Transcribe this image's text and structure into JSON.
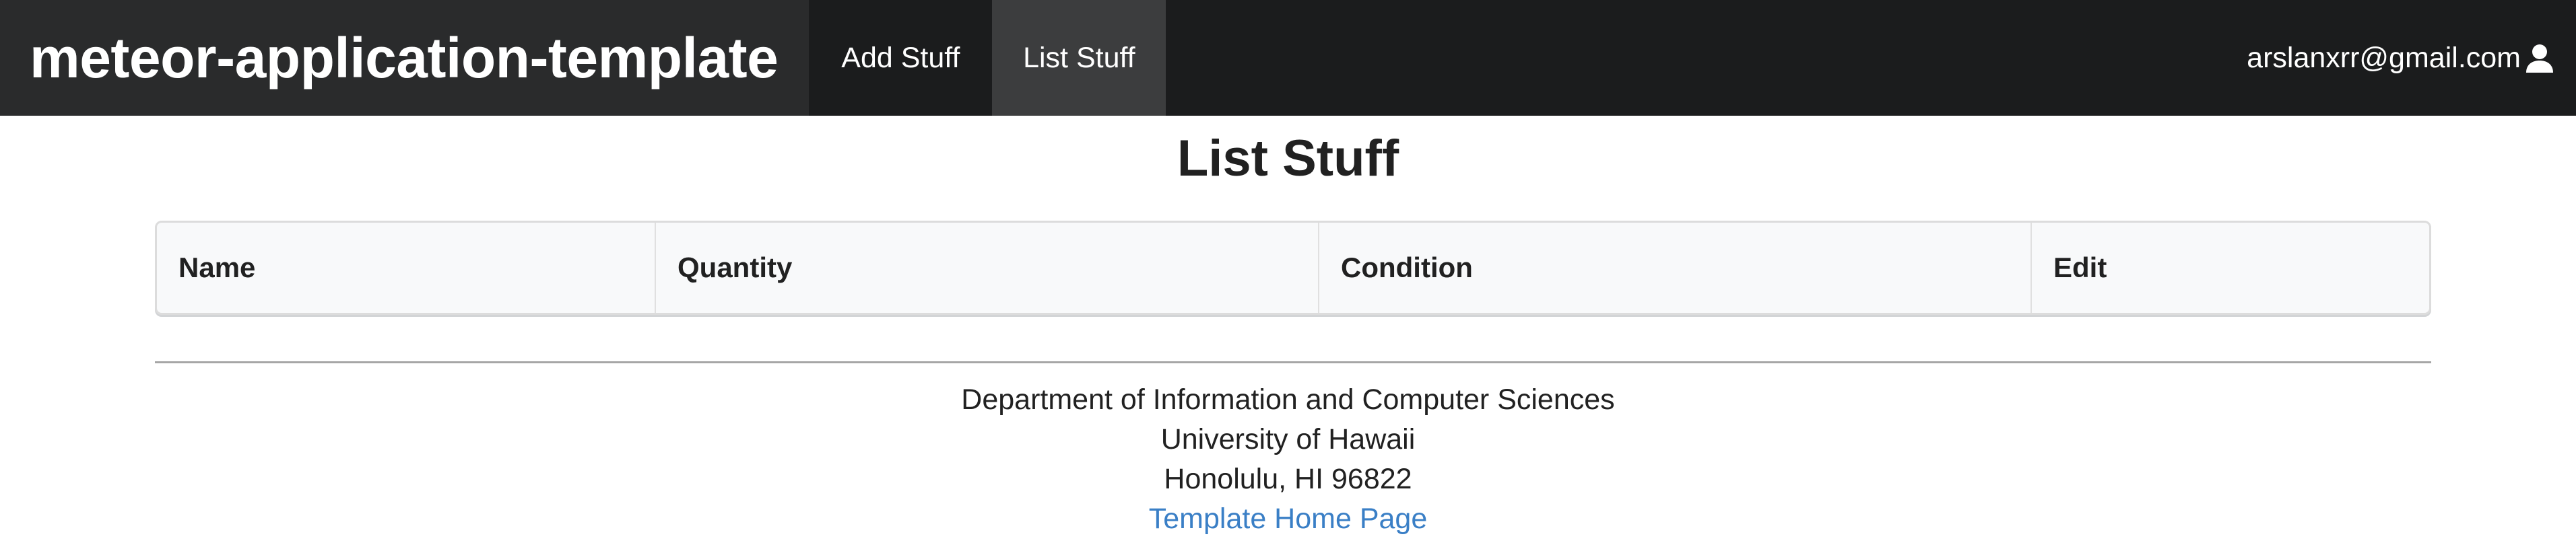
{
  "navbar": {
    "brand": "meteor-application-template",
    "items": [
      {
        "label": "Add Stuff",
        "active": false
      },
      {
        "label": "List Stuff",
        "active": true
      }
    ],
    "user_email": "arslanxrr@gmail.com",
    "user_icon": "user-icon"
  },
  "main": {
    "title": "List Stuff",
    "table": {
      "columns": [
        "Name",
        "Quantity",
        "Condition",
        "Edit"
      ],
      "rows": []
    }
  },
  "footer": {
    "lines": [
      "Department of Information and Computer Sciences",
      "University of Hawaii",
      "Honolulu, HI 96822"
    ],
    "link_label": "Template Home Page"
  },
  "colors": {
    "navbar_bg": "#1b1c1d",
    "active_tab_bg": "#3c3d3e",
    "link": "#3a7fc6"
  }
}
